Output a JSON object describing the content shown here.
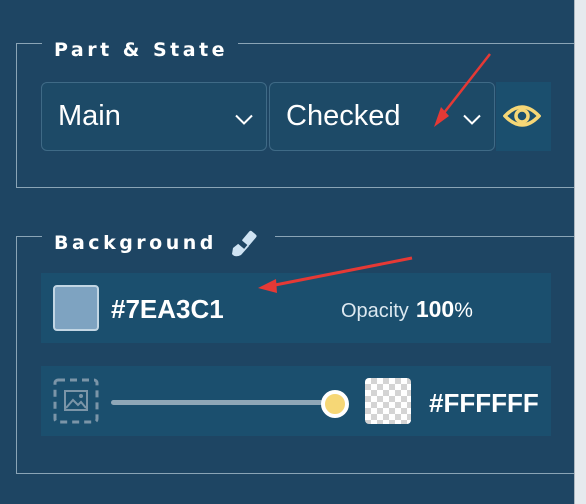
{
  "part_state": {
    "legend": "Part & State",
    "part_select": {
      "value": "Main"
    },
    "state_select": {
      "value": "Checked"
    },
    "visibility_icon": "eye-icon"
  },
  "background": {
    "legend": "Background",
    "legend_icon": "paint-brush-icon",
    "color": {
      "swatch_color": "#7EA3C1",
      "hex": "#7EA3C1",
      "opacity_label": "Opacity",
      "opacity_value": "100",
      "opacity_unit": "%"
    },
    "image_row": {
      "image_icon": "image-placeholder-icon",
      "slider_level": 1.0,
      "recolor_hex": "#FFFFFF"
    }
  },
  "colors": {
    "panel_bg": "#1E4563",
    "accent_yellow": "#F6D776",
    "annotation_red": "#E53935"
  }
}
